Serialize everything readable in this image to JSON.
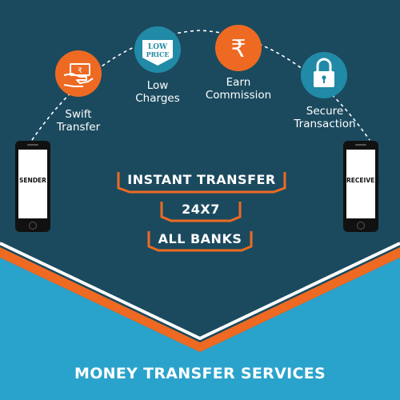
{
  "features": {
    "swift_transfer": "Swift\nTransfer",
    "low_charges": "Low\nCharges",
    "earn_commission": "Earn\nCommission",
    "secure_transaction": "Secure\nTransaction"
  },
  "badge": {
    "line1": "LOW",
    "line2": "PRICE"
  },
  "phones": {
    "sender": "SENDER",
    "receiver": "RECEIVER"
  },
  "banners": {
    "instant": "INSTANT TRANSFER",
    "hours": "24X7",
    "banks": "ALL BANKS"
  },
  "footer": {
    "title": "MONEY TRANSFER SERVICES"
  },
  "colors": {
    "background": "#1b4a5e",
    "orange": "#ee6a22",
    "teal_circle": "#218aa6",
    "lower_band": "#2aa3cc",
    "white": "#ffffff"
  },
  "icons": [
    "hand-cash-icon",
    "low-price-tag-icon",
    "rupee-icon",
    "padlock-icon",
    "smartphone-icon"
  ]
}
